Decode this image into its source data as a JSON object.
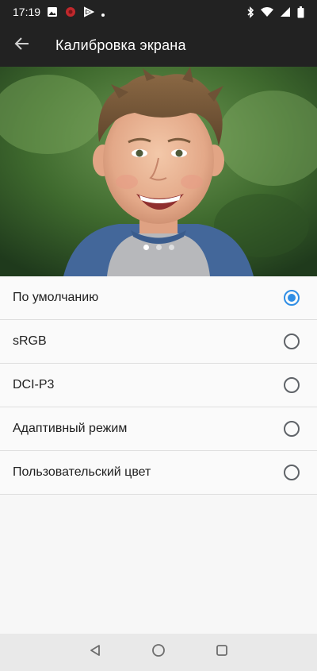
{
  "status_bar": {
    "time": "17:19",
    "left_icons": [
      "image-notification-icon",
      "bug-notification-icon",
      "play-notification-icon",
      "dot-icon"
    ],
    "right_icons": [
      "bluetooth-icon",
      "wifi-icon",
      "signal-icon",
      "battery-icon"
    ]
  },
  "app_bar": {
    "title": "Калибровка экрана",
    "back_icon": "arrow-back-icon"
  },
  "carousel": {
    "page_count": 3,
    "active_page": 1
  },
  "options": [
    {
      "label": "По умолчанию",
      "selected": true
    },
    {
      "label": "sRGB",
      "selected": false
    },
    {
      "label": "DCI-P3",
      "selected": false
    },
    {
      "label": "Адаптивный режим",
      "selected": false
    },
    {
      "label": "Пользовательский цвет",
      "selected": false
    }
  ],
  "nav_bar": {
    "buttons": [
      "back-triangle-icon",
      "home-circle-icon",
      "recents-square-icon"
    ]
  },
  "colors": {
    "toolbar_bg": "#222222",
    "accent": "#2f8ee5",
    "list_bg": "#fafafa",
    "nav_bg": "#e9e9e9"
  }
}
